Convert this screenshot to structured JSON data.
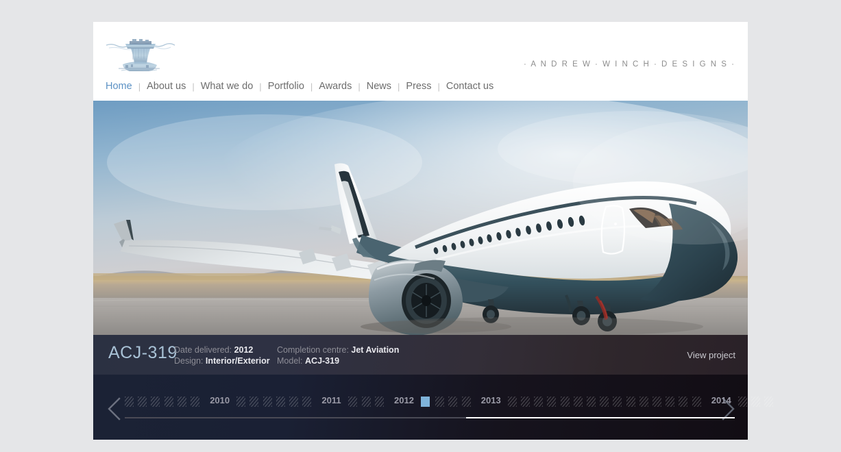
{
  "brand": {
    "wordmark": "· A N D R E W · W I N C H · D E S I G N S ·",
    "logo_icon": "ship-watercolor-logo"
  },
  "nav": {
    "separator": "|",
    "items": [
      {
        "label": "Home",
        "active": true
      },
      {
        "label": "About us",
        "active": false
      },
      {
        "label": "What we do",
        "active": false
      },
      {
        "label": "Portfolio",
        "active": false
      },
      {
        "label": "Awards",
        "active": false
      },
      {
        "label": "News",
        "active": false
      },
      {
        "label": "Press",
        "active": false
      },
      {
        "label": "Contact us",
        "active": false
      }
    ]
  },
  "hero": {
    "alt": "private-jet-on-tarmac-photo",
    "icon": "airplane-photo"
  },
  "project": {
    "title": "ACJ-319",
    "fields": [
      {
        "label": "Date delivered:",
        "value": "2012"
      },
      {
        "label": "Design:",
        "value": "Interior/Exterior"
      },
      {
        "label": "Completion centre:",
        "value": "Jet Aviation"
      },
      {
        "label": "Model:",
        "value": "ACJ-319"
      }
    ],
    "view_project_label": "View project"
  },
  "timeline": {
    "prev_icon": "chevron-left-icon",
    "next_icon": "chevron-right-icon",
    "years": [
      "2010",
      "2011",
      "2012",
      "2013",
      "2014"
    ],
    "selected_year": "2012",
    "selected_marker_color": "#7fb3da",
    "progress_percent": 56,
    "track_color": "#4a4a55",
    "fill_color": "#ffffff"
  },
  "colors": {
    "page_background": "#e5e6e8",
    "site_background": "#ffffff",
    "nav_active": "#5b91c4",
    "nav_inactive": "#6d6d6d",
    "title_accent": "#a9c2d6"
  }
}
